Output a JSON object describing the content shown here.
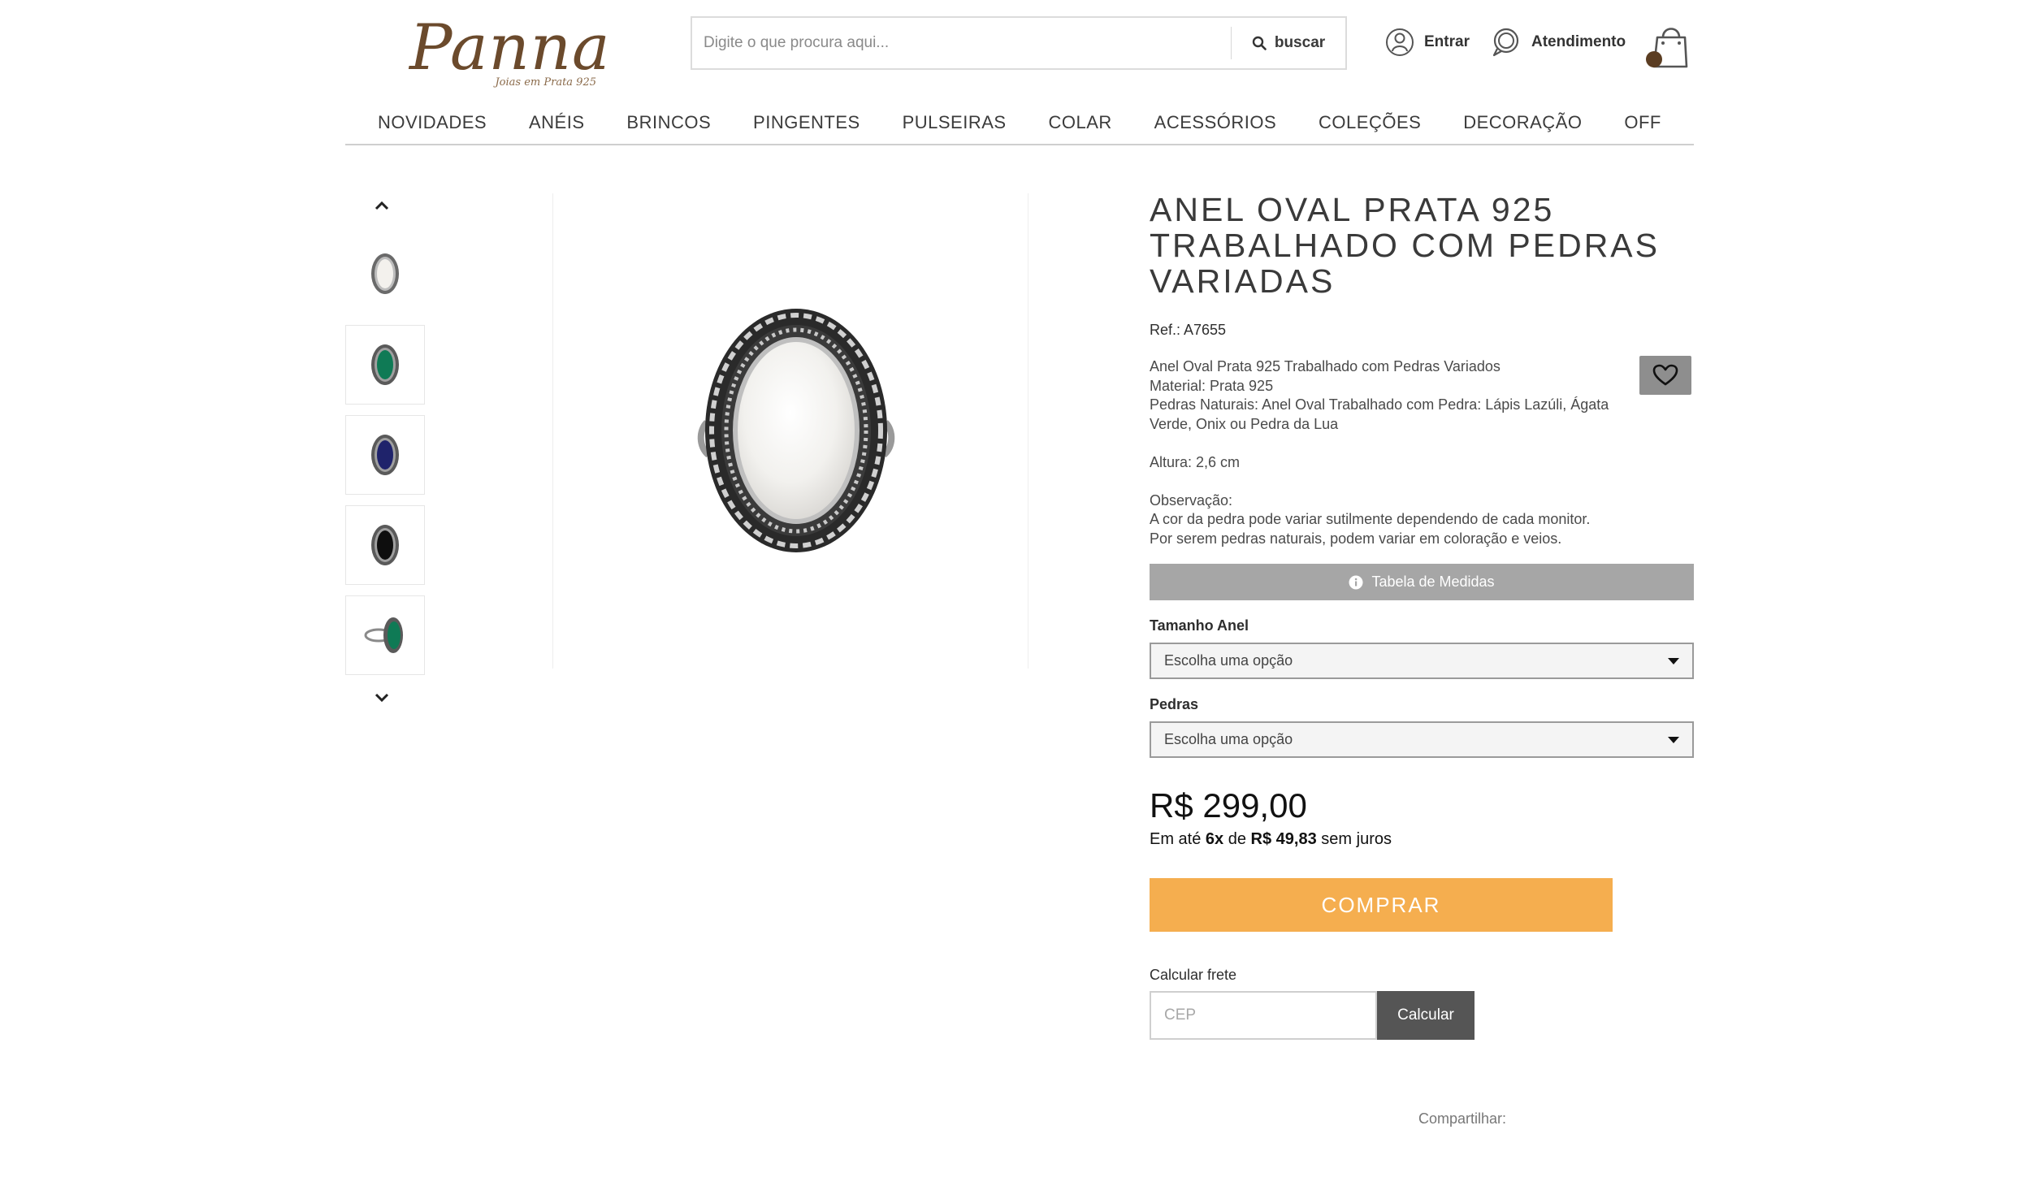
{
  "brand": {
    "name": "Panna",
    "tagline": "Joias em Prata 925",
    "color": "#6b4a2c"
  },
  "search": {
    "placeholder": "Digite o que procura aqui...",
    "button_label": "buscar",
    "icon": "search-icon"
  },
  "header_links": {
    "login": {
      "label": "Entrar",
      "icon": "user-icon"
    },
    "support": {
      "label": "Atendimento",
      "icon": "chat-icon"
    },
    "cart": {
      "icon": "shopping-bag-icon"
    }
  },
  "nav": [
    "NOVIDADES",
    "ANÉIS",
    "BRINCOS",
    "PINGENTES",
    "PULSEIRAS",
    "COLAR",
    "ACESSÓRIOS",
    "COLEÇÕES",
    "DECORAÇÃO",
    "OFF"
  ],
  "gallery": {
    "thumbnails": [
      {
        "stone": "white",
        "color": "#f3f1ed"
      },
      {
        "stone": "green",
        "color": "#0f7a55"
      },
      {
        "stone": "blue",
        "color": "#1f236b"
      },
      {
        "stone": "black",
        "color": "#0e0e0e"
      },
      {
        "stone": "green-side",
        "color": "#0f7a55"
      }
    ]
  },
  "product": {
    "title": "ANEL OVAL PRATA 925 TRABALHADO COM PEDRAS VARIADAS",
    "ref": "Ref.: A7655",
    "description": {
      "line1": "Anel Oval Prata 925 Trabalhado com Pedras Variados",
      "line2": "Material: Prata 925",
      "line3": "Pedras Naturais: Anel Oval Trabalhado com Pedra: Lápis Lazúli, Ágata Verde, Onix ou Pedra da Lua",
      "line4": "Altura: 2,6 cm",
      "line5": "Observação:",
      "line6": "A cor da pedra pode variar sutilmente dependendo de cada monitor.",
      "line7": "Por serem pedras naturais, podem variar em coloração e veios."
    },
    "size_table_label": "Tabela de Medidas",
    "size_label": "Tamanho Anel",
    "size_value": "Escolha uma opção",
    "stone_label": "Pedras",
    "stone_value": "Escolha uma opção",
    "price": "R$ 299,00",
    "installments": {
      "prefix": "Em até",
      "count": "6x",
      "mid": "de",
      "amount": "R$ 49,83",
      "suffix": "sem juros"
    },
    "buy_label": "COMPRAR",
    "buy_color": "#f5ae4f",
    "shipping_label": "Calcular frete",
    "cep_placeholder": "CEP",
    "calc_label": "Calcular",
    "share_label": "Compartilhar:"
  }
}
